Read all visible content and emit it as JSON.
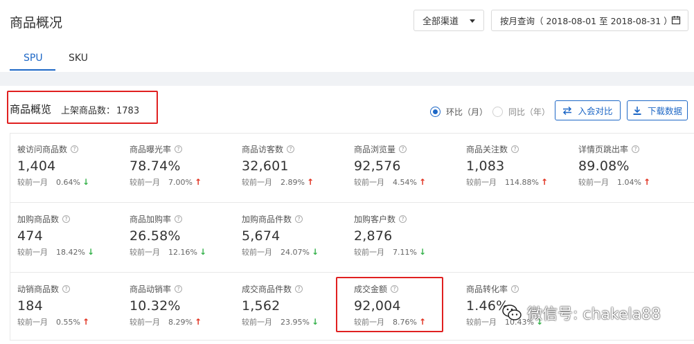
{
  "header": {
    "title": "商品概况",
    "channel": "全部渠道",
    "date_range": "按月查询（ 2018-08-01 至 2018-08-31 ）"
  },
  "tabs": [
    {
      "label": "SPU",
      "active": true
    },
    {
      "label": "SKU",
      "active": false
    }
  ],
  "section": {
    "title": "商品概览",
    "count_label": "上架商品数：",
    "count_value": "1783"
  },
  "compare": {
    "options": [
      {
        "label": "环比（月）",
        "selected": true
      },
      {
        "label": "同比（年）",
        "selected": false
      }
    ],
    "add_compare_label": "入会对比",
    "download_label": "下载数据"
  },
  "compare_prefix": "较前一月",
  "metrics": [
    [
      {
        "name": "被访问商品数",
        "value": "1,404",
        "pct": "0.64%",
        "dir": "down"
      },
      {
        "name": "商品曝光率",
        "value": "78.74%",
        "pct": "7.00%",
        "dir": "up"
      },
      {
        "name": "商品访客数",
        "value": "32,601",
        "pct": "2.89%",
        "dir": "up"
      },
      {
        "name": "商品浏览量",
        "value": "92,576",
        "pct": "4.54%",
        "dir": "up"
      },
      {
        "name": "商品关注数",
        "value": "1,083",
        "pct": "114.88%",
        "dir": "up"
      },
      {
        "name": "详情页跳出率",
        "value": "89.08%",
        "pct": "1.04%",
        "dir": "up"
      }
    ],
    [
      {
        "name": "加购商品数",
        "value": "474",
        "pct": "18.42%",
        "dir": "down"
      },
      {
        "name": "商品加购率",
        "value": "26.58%",
        "pct": "12.16%",
        "dir": "down"
      },
      {
        "name": "加购商品件数",
        "value": "5,674",
        "pct": "24.07%",
        "dir": "down"
      },
      {
        "name": "加购客户数",
        "value": "2,876",
        "pct": "7.11%",
        "dir": "down"
      }
    ],
    [
      {
        "name": "动销商品数",
        "value": "184",
        "pct": "0.55%",
        "dir": "up"
      },
      {
        "name": "商品动销率",
        "value": "10.32%",
        "pct": "8.29%",
        "dir": "up"
      },
      {
        "name": "成交商品件数",
        "value": "1,562",
        "pct": "23.95%",
        "dir": "down"
      },
      {
        "name": "成交金额",
        "value": "92,004",
        "pct": "8.76%",
        "dir": "up"
      },
      {
        "name": "商品转化率",
        "value": "1.46%",
        "pct": "10.43%",
        "dir": "down"
      }
    ]
  ],
  "watermark": "微信号: chakela88",
  "colors": {
    "accent": "#1d67c6",
    "up": "#e0301e",
    "down": "#37b24d",
    "highlight": "#e02020"
  }
}
